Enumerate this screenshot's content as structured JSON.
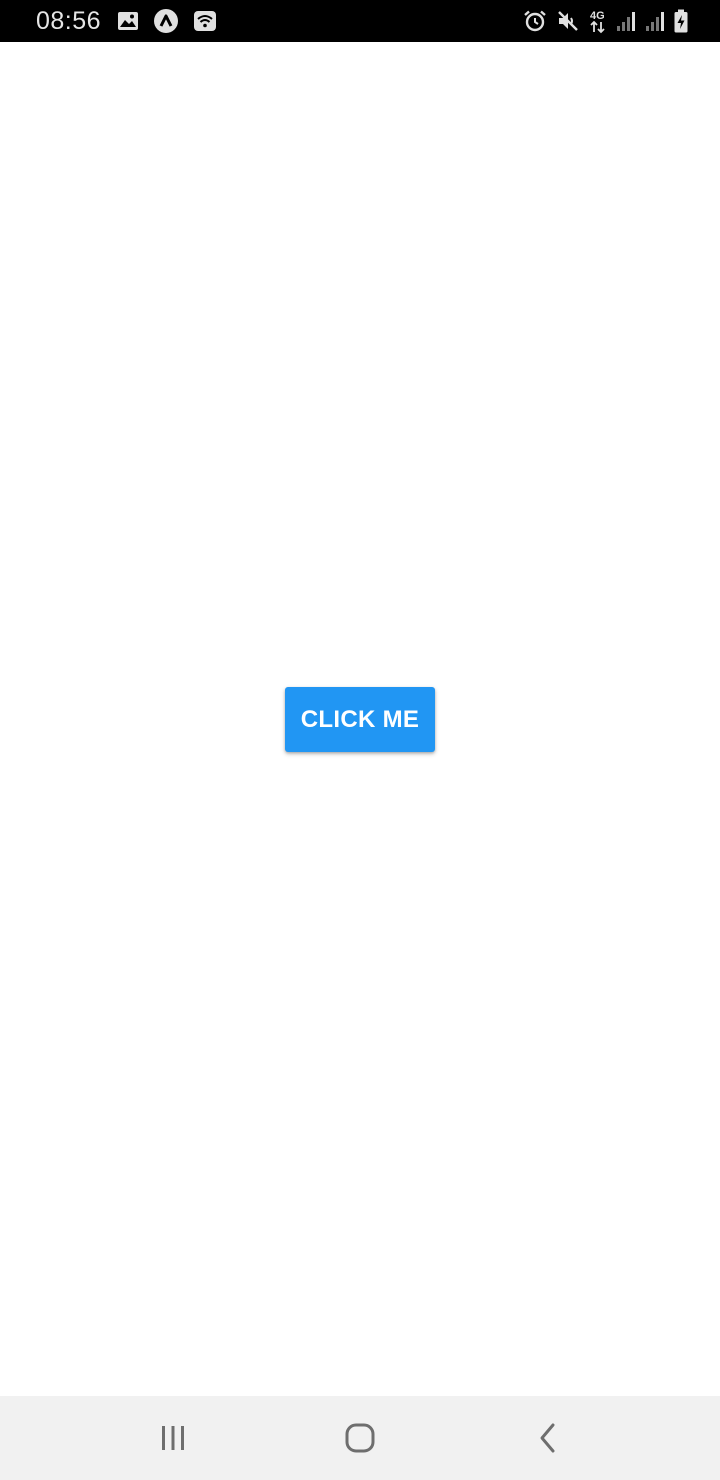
{
  "status_bar": {
    "time": "08:56",
    "network_label": "4G",
    "left_icons": [
      "image-icon",
      "app-notification-icon",
      "wifi-hotspot-icon"
    ],
    "right_icons": [
      "alarm-icon",
      "mute-icon",
      "network-4g-icon",
      "signal-icon",
      "signal-icon",
      "battery-charging-icon"
    ]
  },
  "main": {
    "button_label": "CLICK ME"
  },
  "nav_bar": {
    "buttons": [
      "recent-apps-icon",
      "home-icon",
      "back-icon"
    ]
  },
  "colors": {
    "accent": "#2196f3",
    "status_bar_bg": "#000000",
    "nav_bar_bg": "#f1f1f1",
    "background": "#ffffff"
  }
}
